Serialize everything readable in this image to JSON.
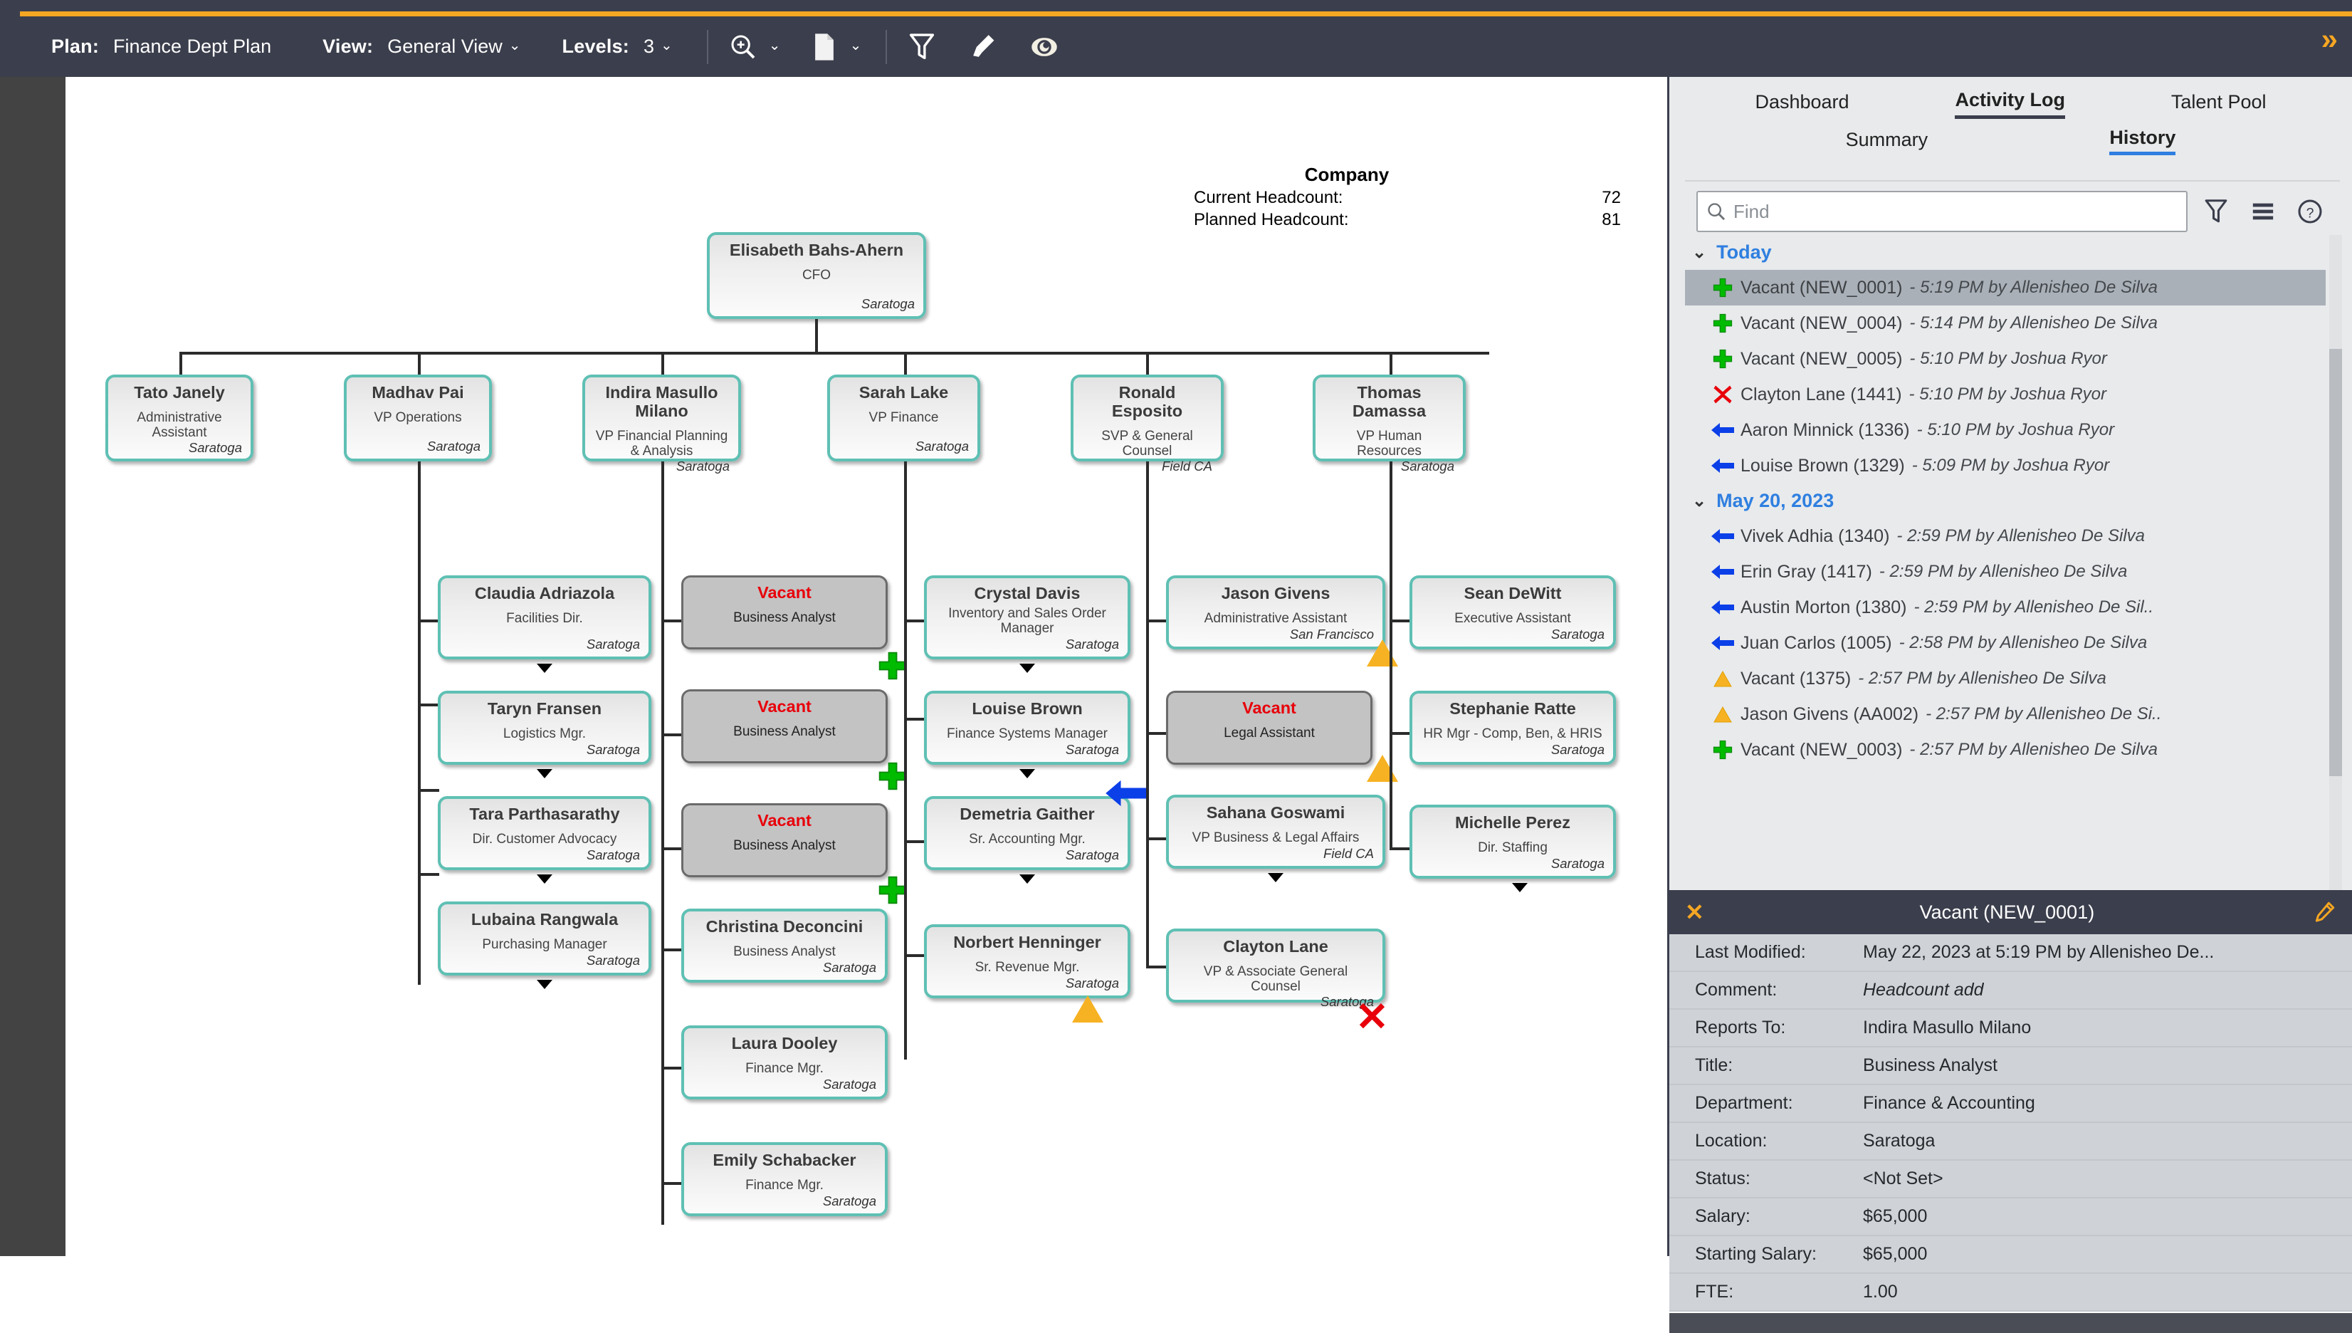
{
  "toolbar": {
    "plan_label": "Plan:",
    "plan_value": "Finance Dept Plan",
    "view_label": "View:",
    "view_value": "General View",
    "levels_label": "Levels:",
    "levels_value": "3",
    "icons": [
      "zoom-icon",
      "page-icon",
      "filter-icon",
      "highlighter-icon",
      "visibility-icon"
    ],
    "expand_glyph": "»"
  },
  "chart": {
    "company_title": "Company",
    "current_headcount_label": "Current Headcount:",
    "current_headcount_value": "72",
    "planned_headcount_label": "Planned Headcount:",
    "planned_headcount_value": "81",
    "root": {
      "name": "Elisabeth Bahs-Ahern",
      "title": "CFO",
      "location": "Saratoga"
    },
    "level2": [
      {
        "name": "Tato Janely",
        "title": "Administrative Assistant",
        "location": "Saratoga"
      },
      {
        "name": "Madhav Pai",
        "title": "VP Operations",
        "location": "Saratoga"
      },
      {
        "name": "Indira Masullo Milano",
        "title": "VP Financial Planning & Analysis",
        "location": "Saratoga"
      },
      {
        "name": "Sarah Lake",
        "title": "VP Finance",
        "location": "Saratoga"
      },
      {
        "name": "Ronald Esposito",
        "title": "SVP & General Counsel",
        "location": "Field CA"
      },
      {
        "name": "Thomas Damassa",
        "title": "VP Human Resources",
        "location": "Saratoga"
      }
    ],
    "col_madhav": [
      {
        "name": "Claudia Adriazola",
        "title": "Facilities Dir.",
        "location": "Saratoga"
      },
      {
        "name": "Taryn Fransen",
        "title": "Logistics Mgr.",
        "location": "Saratoga"
      },
      {
        "name": "Tara Parthasarathy",
        "title": "Dir. Customer Advocacy",
        "location": "Saratoga"
      },
      {
        "name": "Lubaina Rangwala",
        "title": "Purchasing Manager",
        "location": "Saratoga"
      }
    ],
    "col_indira": [
      {
        "name": "Vacant",
        "title": "Business Analyst",
        "location": "",
        "vacant": true
      },
      {
        "name": "Vacant",
        "title": "Business Analyst",
        "location": "",
        "vacant": true
      },
      {
        "name": "Vacant",
        "title": "Business Analyst",
        "location": "",
        "vacant": true
      },
      {
        "name": "Christina Deconcini",
        "title": "Business Analyst",
        "location": "Saratoga"
      },
      {
        "name": "Laura Dooley",
        "title": "Finance Mgr.",
        "location": "Saratoga"
      },
      {
        "name": "Emily Schabacker",
        "title": "Finance Mgr.",
        "location": "Saratoga"
      }
    ],
    "col_sarah": [
      {
        "name": "Crystal Davis",
        "title": "Inventory and Sales Order Manager",
        "location": "Saratoga"
      },
      {
        "name": "Louise Brown",
        "title": "Finance Systems Manager",
        "location": "Saratoga"
      },
      {
        "name": "Demetria Gaither",
        "title": "Sr. Accounting Mgr.",
        "location": "Saratoga"
      },
      {
        "name": "Norbert Henninger",
        "title": "Sr. Revenue Mgr.",
        "location": "Saratoga"
      }
    ],
    "col_ronald": [
      {
        "name": "Jason Givens",
        "title": "Administrative Assistant",
        "location": "San Francisco"
      },
      {
        "name": "Vacant",
        "title": "Legal Assistant",
        "location": "",
        "vacant": true
      },
      {
        "name": "Sahana Goswami",
        "title": "VP Business & Legal Affairs",
        "location": "Field CA"
      },
      {
        "name": "Clayton Lane",
        "title": "VP & Associate General Counsel",
        "location": "Saratoga"
      }
    ],
    "col_thomas": [
      {
        "name": "Sean DeWitt",
        "title": "Executive Assistant",
        "location": "Saratoga"
      },
      {
        "name": "Stephanie Ratte",
        "title": "HR Mgr - Comp, Ben, & HRIS",
        "location": "Saratoga"
      },
      {
        "name": "Michelle Perez",
        "title": "Dir. Staffing",
        "location": "Saratoga"
      }
    ]
  },
  "panel": {
    "primary_tabs": [
      {
        "label": "Dashboard",
        "active": false
      },
      {
        "label": "Activity Log",
        "active": true
      },
      {
        "label": "Talent Pool",
        "active": false
      }
    ],
    "secondary_tabs": [
      {
        "label": "Summary",
        "active": false
      },
      {
        "label": "History",
        "active": true
      }
    ],
    "search_placeholder": "Find",
    "search_value": "",
    "search_icons": [
      "filter-icon",
      "list-icon",
      "help-icon"
    ],
    "history_groups": [
      {
        "label": "Today",
        "entries": [
          {
            "icon": "plus-icon",
            "subject": "Vacant (NEW_0001)",
            "meta": "- 5:19 PM by Allenisheo De Silva",
            "selected": true
          },
          {
            "icon": "plus-icon",
            "subject": "Vacant (NEW_0004)",
            "meta": "- 5:14 PM by Allenisheo De Silva",
            "selected": false
          },
          {
            "icon": "plus-icon",
            "subject": "Vacant (NEW_0005)",
            "meta": "- 5:10 PM by Joshua Ryor",
            "selected": false
          },
          {
            "icon": "x-icon",
            "subject": "Clayton Lane (1441)",
            "meta": "- 5:10 PM by Joshua Ryor",
            "selected": false
          },
          {
            "icon": "arrow-icon",
            "subject": "Aaron Minnick (1336)",
            "meta": "- 5:10 PM by Joshua Ryor",
            "selected": false
          },
          {
            "icon": "arrow-icon",
            "subject": "Louise Brown (1329)",
            "meta": "- 5:09 PM by Joshua Ryor",
            "selected": false
          }
        ]
      },
      {
        "label": "May 20, 2023",
        "entries": [
          {
            "icon": "arrow-icon",
            "subject": "Vivek Adhia (1340)",
            "meta": "- 2:59 PM by Allenisheo De Silva",
            "selected": false
          },
          {
            "icon": "arrow-icon",
            "subject": "Erin Gray (1417)",
            "meta": "- 2:59 PM by Allenisheo De Silva",
            "selected": false
          },
          {
            "icon": "arrow-icon",
            "subject": "Austin Morton (1380)",
            "meta": "- 2:59 PM by Allenisheo De Sil..",
            "selected": false
          },
          {
            "icon": "arrow-icon",
            "subject": "Juan Carlos (1005)",
            "meta": "- 2:58 PM by Allenisheo De Silva",
            "selected": false
          },
          {
            "icon": "tri-icon",
            "subject": "Vacant (1375)",
            "meta": "- 2:57 PM by Allenisheo De Silva",
            "selected": false
          },
          {
            "icon": "tri-icon",
            "subject": "Jason Givens (AA002)",
            "meta": "- 2:57 PM by Allenisheo De Si..",
            "selected": false
          },
          {
            "icon": "plus-icon",
            "subject": "Vacant (NEW_0003)",
            "meta": "- 2:57 PM by Allenisheo De Silva",
            "selected": false
          }
        ]
      }
    ],
    "detail": {
      "title": "Vacant (NEW_0001)",
      "close_glyph": "✕",
      "rows": [
        {
          "key": "Last Modified:",
          "value": "May 22, 2023 at 5:19 PM by Allenisheo De...",
          "italic": false
        },
        {
          "key": "Comment:",
          "value": "Headcount add",
          "italic": true
        },
        {
          "key": "Reports To:",
          "value": "Indira Masullo Milano",
          "italic": false
        },
        {
          "key": "Title:",
          "value": "Business Analyst",
          "italic": false
        },
        {
          "key": "Department:",
          "value": "Finance & Accounting",
          "italic": false
        },
        {
          "key": "Location:",
          "value": "Saratoga",
          "italic": false
        },
        {
          "key": "Status:",
          "value": "<Not Set>",
          "italic": false
        },
        {
          "key": "Salary:",
          "value": "$65,000",
          "italic": false
        },
        {
          "key": "Starting Salary:",
          "value": "$65,000",
          "italic": false
        },
        {
          "key": "FTE:",
          "value": "1.00",
          "italic": false
        }
      ]
    }
  },
  "colors": {
    "topbar": "#3b3e4c",
    "accent": "#f5a623",
    "node_border": "#5fc0b4",
    "vacant_text": "#e8000a",
    "link_blue": "#2f7fe0",
    "marker_green": "#00bb00",
    "marker_yellow": "#f7b223"
  }
}
